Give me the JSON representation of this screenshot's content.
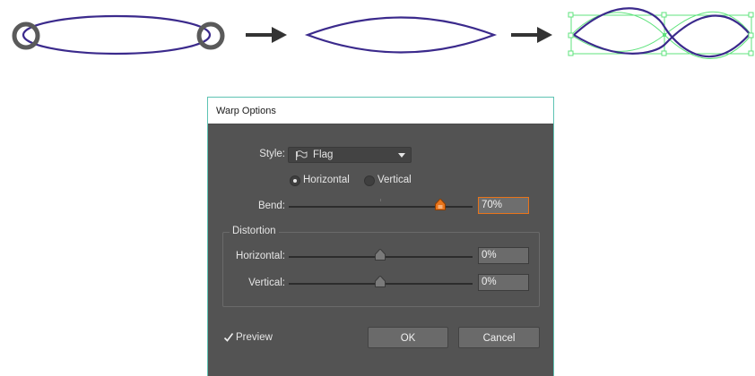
{
  "dialog": {
    "title": "Warp Options",
    "style": {
      "label": "Style:",
      "value": "Flag",
      "icon": "flag-icon"
    },
    "orientation": {
      "horizontal_label": "Horizontal",
      "vertical_label": "Vertical",
      "selected": "Horizontal"
    },
    "bend": {
      "label": "Bend:",
      "value": "70%",
      "level": 0.7
    },
    "distortion": {
      "group_label": "Distortion",
      "horizontal": {
        "label": "Horizontal:",
        "value": "0%",
        "level": 0.0
      },
      "vertical": {
        "label": "Vertical:",
        "value": "0%",
        "level": 0.0
      }
    },
    "preview": {
      "label": "Preview",
      "checked": true
    },
    "buttons": {
      "ok": "OK",
      "cancel": "Cancel"
    }
  },
  "colors": {
    "shape_stroke": "#3b2a8c",
    "handle_ring": "#5a5a5a",
    "selection": "#5fe37d",
    "arrow": "#333333",
    "dialog_bg": "#535353",
    "dialog_border": "#5ec3b3",
    "focus": "#e8741a"
  }
}
